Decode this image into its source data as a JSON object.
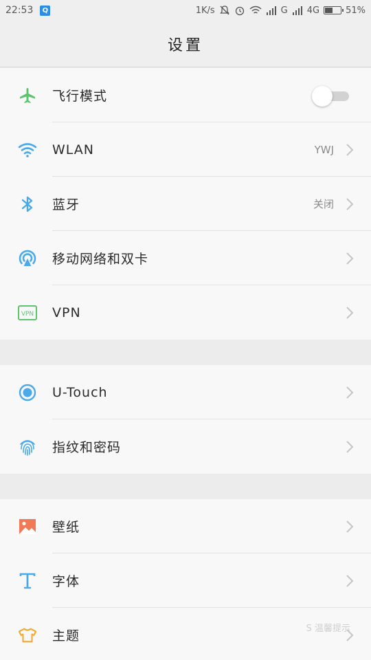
{
  "status_bar": {
    "time": "22:53",
    "app_icon_letter": "Q",
    "net_speed": "1K/s",
    "network_g": "G",
    "network_4g": "4G",
    "battery_percent": "51%",
    "battery_level": 0.51
  },
  "header": {
    "title": "设置"
  },
  "groups": [
    {
      "items": [
        {
          "icon": "airplane-icon",
          "label": "飞行模式",
          "toggle": false
        },
        {
          "icon": "wifi-icon",
          "label": "WLAN",
          "value": "YWJ"
        },
        {
          "icon": "bluetooth-icon",
          "label": "蓝牙",
          "value": "关闭"
        },
        {
          "icon": "mobile-network-icon",
          "label": "移动网络和双卡"
        },
        {
          "icon": "vpn-icon",
          "label": "VPN"
        }
      ]
    },
    {
      "items": [
        {
          "icon": "utouch-icon",
          "label": "U-Touch"
        },
        {
          "icon": "fingerprint-icon",
          "label": "指纹和密码"
        }
      ]
    },
    {
      "items": [
        {
          "icon": "wallpaper-icon",
          "label": "壁纸"
        },
        {
          "icon": "font-icon",
          "label": "字体"
        },
        {
          "icon": "theme-icon",
          "label": "主题"
        }
      ]
    }
  ],
  "watermark": "S 温馨提示",
  "colors": {
    "airplane": "#5cc36e",
    "blue": "#4aa9e8",
    "vpn": "#5cc36e",
    "wallpaper": "#ef7a55",
    "theme": "#f0a830"
  }
}
